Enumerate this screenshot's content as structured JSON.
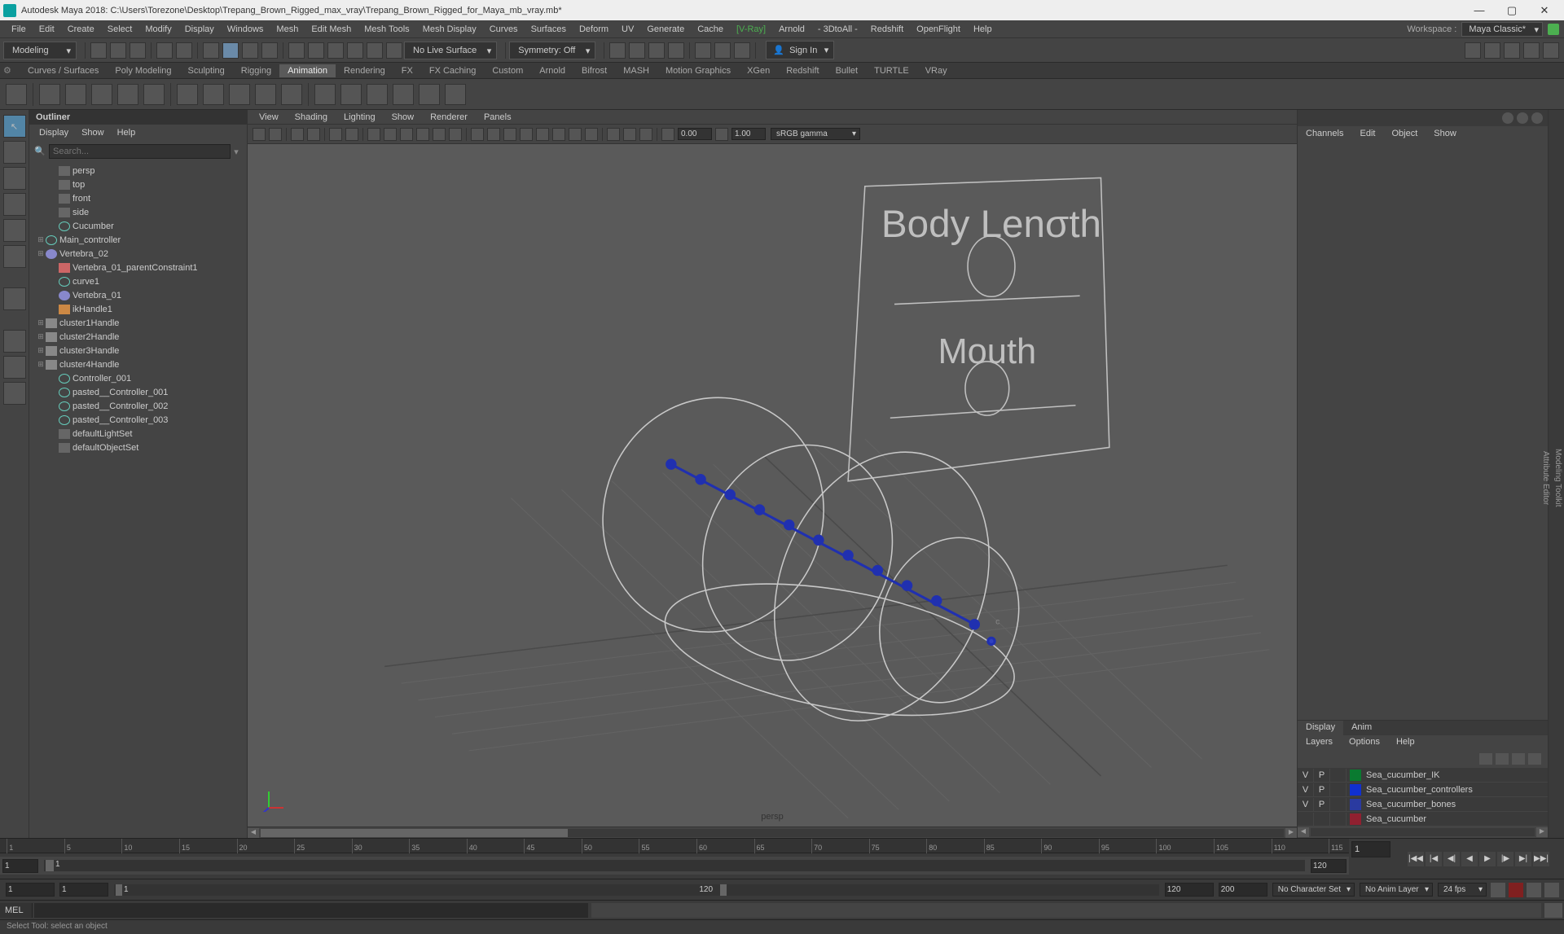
{
  "titlebar": {
    "title": "Autodesk Maya 2018: C:\\Users\\Torezone\\Desktop\\Trepang_Brown_Rigged_max_vray\\Trepang_Brown_Rigged_for_Maya_mb_vray.mb*"
  },
  "menubar": {
    "items": [
      "File",
      "Edit",
      "Create",
      "Select",
      "Modify",
      "Display",
      "Windows",
      "Mesh",
      "Edit Mesh",
      "Mesh Tools",
      "Mesh Display",
      "Curves",
      "Surfaces",
      "Deform",
      "UV",
      "Generate",
      "Cache",
      "[V-Ray]",
      "Arnold",
      "- 3DtoAll -",
      "Redshift",
      "OpenFlight",
      "Help"
    ],
    "workspace_label": "Workspace :",
    "workspace_value": "Maya Classic*"
  },
  "statusline": {
    "module": "Modeling",
    "live_surface": "No Live Surface",
    "symmetry": "Symmetry: Off",
    "signin": "Sign In"
  },
  "shelf": {
    "tabs": [
      "Curves / Surfaces",
      "Poly Modeling",
      "Sculpting",
      "Rigging",
      "Animation",
      "Rendering",
      "FX",
      "FX Caching",
      "Custom",
      "Arnold",
      "Bifrost",
      "MASH",
      "Motion Graphics",
      "XGen",
      "Redshift",
      "Bullet",
      "TURTLE",
      "VRay"
    ],
    "active_tab": "Animation"
  },
  "outliner": {
    "title": "Outliner",
    "menus": [
      "Display",
      "Show",
      "Help"
    ],
    "search_placeholder": "Search...",
    "items": [
      {
        "indent": 1,
        "icon": "cam",
        "name": "persp",
        "exp": ""
      },
      {
        "indent": 1,
        "icon": "cam",
        "name": "top",
        "exp": ""
      },
      {
        "indent": 1,
        "icon": "cam",
        "name": "front",
        "exp": ""
      },
      {
        "indent": 1,
        "icon": "cam",
        "name": "side",
        "exp": ""
      },
      {
        "indent": 1,
        "icon": "curve",
        "name": "Cucumber",
        "exp": ""
      },
      {
        "indent": 0,
        "icon": "curve",
        "name": "Main_controller",
        "exp": "⊞"
      },
      {
        "indent": 0,
        "icon": "joint",
        "name": "Vertebra_02",
        "exp": "⊞"
      },
      {
        "indent": 1,
        "icon": "constraint",
        "name": "Vertebra_01_parentConstraint1",
        "exp": ""
      },
      {
        "indent": 1,
        "icon": "curve",
        "name": "curve1",
        "exp": ""
      },
      {
        "indent": 1,
        "icon": "joint",
        "name": "Vertebra_01",
        "exp": ""
      },
      {
        "indent": 1,
        "icon": "ik",
        "name": "ikHandle1",
        "exp": ""
      },
      {
        "indent": 0,
        "icon": "cluster",
        "name": "cluster1Handle",
        "exp": "⊞"
      },
      {
        "indent": 0,
        "icon": "cluster",
        "name": "cluster2Handle",
        "exp": "⊞"
      },
      {
        "indent": 0,
        "icon": "cluster",
        "name": "cluster3Handle",
        "exp": "⊞"
      },
      {
        "indent": 0,
        "icon": "cluster",
        "name": "cluster4Handle",
        "exp": "⊞"
      },
      {
        "indent": 1,
        "icon": "curve",
        "name": "Controller_001",
        "exp": ""
      },
      {
        "indent": 1,
        "icon": "curve",
        "name": "pasted__Controller_001",
        "exp": ""
      },
      {
        "indent": 1,
        "icon": "curve",
        "name": "pasted__Controller_002",
        "exp": ""
      },
      {
        "indent": 1,
        "icon": "curve",
        "name": "pasted__Controller_003",
        "exp": ""
      },
      {
        "indent": 1,
        "icon": "set",
        "name": "defaultLightSet",
        "exp": ""
      },
      {
        "indent": 1,
        "icon": "set",
        "name": "defaultObjectSet",
        "exp": ""
      }
    ]
  },
  "viewport": {
    "menus": [
      "View",
      "Shading",
      "Lighting",
      "Show",
      "Renderer",
      "Panels"
    ],
    "exposure": "0.00",
    "gamma": "1.00",
    "color_space": "sRGB gamma",
    "camera": "persp",
    "panel_label1": "Body Lenσth",
    "panel_label2": "Mouth"
  },
  "channelbox": {
    "tabs": [
      "Channels",
      "Edit",
      "Object",
      "Show"
    ],
    "layers_tabs": [
      "Display",
      "Anim"
    ],
    "layers_menus": [
      "Layers",
      "Options",
      "Help"
    ],
    "layers": [
      {
        "v": "V",
        "p": "P",
        "color": "#0a7a30",
        "name": "Sea_cucumber_IK"
      },
      {
        "v": "V",
        "p": "P",
        "color": "#1030d0",
        "name": "Sea_cucumber_controllers"
      },
      {
        "v": "V",
        "p": "P",
        "color": "#2a3aa0",
        "name": "Sea_cucumber_bones"
      },
      {
        "v": "",
        "p": "",
        "color": "#902030",
        "name": "Sea_cucumber"
      }
    ]
  },
  "sidetabs": [
    "Modeling Toolkit",
    "Attribute Editor"
  ],
  "timeline": {
    "ticks": [
      "1",
      "5",
      "10",
      "15",
      "20",
      "25",
      "30",
      "35",
      "40",
      "45",
      "50",
      "55",
      "60",
      "65",
      "70",
      "75",
      "80",
      "85",
      "90",
      "95",
      "100",
      "105",
      "110",
      "115"
    ],
    "current_frame": "1",
    "range_start_inner": "1",
    "range_end_inner": "120",
    "slider_frame": "1"
  },
  "rangerow": {
    "start": "1",
    "start_inner": "1",
    "end_inner": "120",
    "end": "200",
    "char_set": "No Character Set",
    "anim_layer": "No Anim Layer",
    "fps": "24 fps"
  },
  "cmdline": {
    "lang": "MEL"
  },
  "helpline": {
    "text": "Select Tool: select an object"
  }
}
